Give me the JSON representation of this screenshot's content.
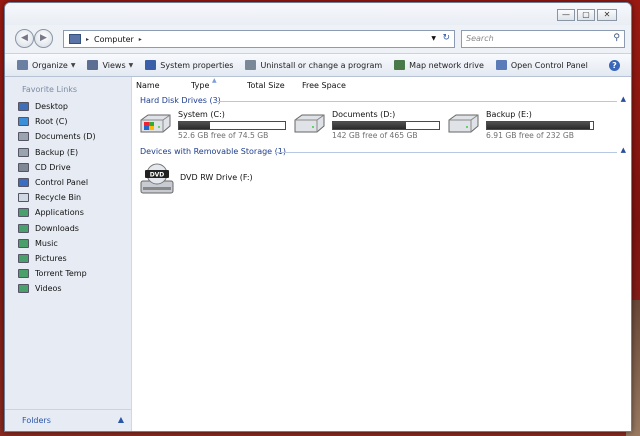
{
  "window": {
    "caption_buttons": {
      "minimize": "—",
      "maximize": "▢",
      "close": "✕"
    }
  },
  "nav": {
    "back_icon": "back-arrow-icon",
    "forward_icon": "forward-arrow-icon",
    "address": {
      "path_sep": "▸",
      "location": "Computer",
      "trailing_sep": "▸"
    },
    "search": {
      "placeholder": "Search"
    }
  },
  "toolbar": {
    "items": [
      {
        "label": "Organize",
        "icon": "organize-icon",
        "has_dropdown": true,
        "color": "#6b7fa2"
      },
      {
        "label": "Views",
        "icon": "views-icon",
        "has_dropdown": true,
        "color": "#5c6f92"
      },
      {
        "label": "System properties",
        "icon": "system-properties-icon",
        "has_dropdown": false,
        "color": "#3a5ea8"
      },
      {
        "label": "Uninstall or change a program",
        "icon": "uninstall-icon",
        "has_dropdown": false,
        "color": "#7a8898"
      },
      {
        "label": "Map network drive",
        "icon": "map-network-drive-icon",
        "has_dropdown": false,
        "color": "#4a7a4a"
      },
      {
        "label": "Open Control Panel",
        "icon": "control-panel-icon",
        "has_dropdown": false,
        "color": "#5a7ab8"
      }
    ],
    "help_label": "?"
  },
  "sidebar": {
    "heading": "Favorite Links",
    "items": [
      {
        "label": "Desktop",
        "icon": "desktop-icon",
        "color": "#3f6fb8"
      },
      {
        "label": "Root (C)",
        "icon": "drive-c-icon",
        "color": "#3a8fd8"
      },
      {
        "label": "Documents (D)",
        "icon": "drive-d-icon",
        "color": "#9aa4ae"
      },
      {
        "label": "Backup (E)",
        "icon": "drive-e-icon",
        "color": "#9aa4ae"
      },
      {
        "label": "CD Drive",
        "icon": "cd-drive-icon",
        "color": "#7e8894"
      },
      {
        "label": "Control Panel",
        "icon": "control-panel-icon",
        "color": "#3a6ec0"
      },
      {
        "label": "Recycle Bin",
        "icon": "recycle-bin-icon",
        "color": "#cfd8e3"
      },
      {
        "label": "Applications",
        "icon": "applications-icon",
        "color": "#4aa06a"
      },
      {
        "label": "Downloads",
        "icon": "downloads-icon",
        "color": "#4aa06a"
      },
      {
        "label": "Music",
        "icon": "music-icon",
        "color": "#4aa06a"
      },
      {
        "label": "Pictures",
        "icon": "pictures-icon",
        "color": "#4aa06a"
      },
      {
        "label": "Torrent Temp",
        "icon": "torrent-temp-icon",
        "color": "#4aa06a"
      },
      {
        "label": "Videos",
        "icon": "videos-icon",
        "color": "#4aa06a"
      }
    ],
    "footer_label": "Folders",
    "footer_caret": "▲"
  },
  "columns": {
    "name": "Name",
    "type": "Type",
    "total_size": "Total Size",
    "free_space": "Free Space",
    "sort_caret": "▲"
  },
  "groups": {
    "hard_disks": {
      "title": "Hard Disk Drives (3)",
      "toggle": "▲",
      "drives": [
        {
          "name": "System (C:)",
          "free_text": "52.6 GB free of 74.5 GB",
          "used_fraction": 0.29,
          "icon": "system-drive-icon"
        },
        {
          "name": "Documents (D:)",
          "free_text": "142 GB free of 465 GB",
          "used_fraction": 0.69,
          "icon": "hard-drive-icon"
        },
        {
          "name": "Backup (E:)",
          "free_text": "6.91 GB free of 232 GB",
          "used_fraction": 0.97,
          "icon": "hard-drive-icon"
        }
      ]
    },
    "removable": {
      "title": "Devices with Removable Storage (1)",
      "toggle": "▲",
      "drives": [
        {
          "name": "DVD RW Drive (F:)",
          "icon": "dvd-drive-icon",
          "icon_text": "DVD"
        }
      ]
    }
  }
}
